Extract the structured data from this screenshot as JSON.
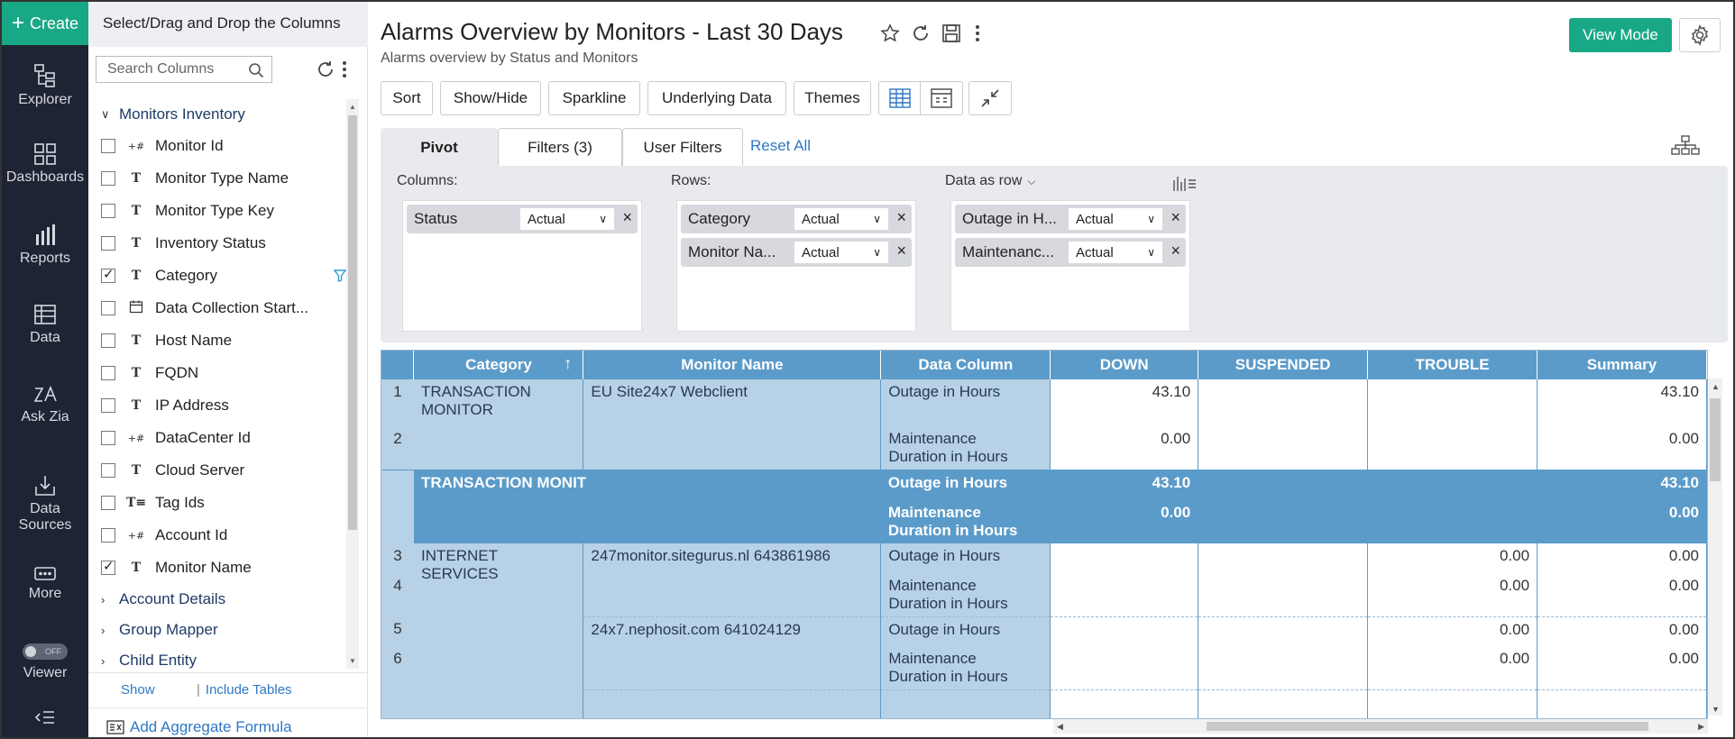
{
  "nav": {
    "create": "Create",
    "items": [
      {
        "label": "Explorer",
        "icon": "explorer-icon"
      },
      {
        "label": "Dashboards",
        "icon": "dashboards-icon"
      },
      {
        "label": "Reports",
        "icon": "reports-icon"
      },
      {
        "label": "Data",
        "icon": "data-icon"
      },
      {
        "label": "Ask Zia",
        "icon": "ask-zia-icon"
      },
      {
        "label": "Data\nSources",
        "line1": "Data",
        "line2": "Sources",
        "icon": "data-sources-icon"
      },
      {
        "label": "More",
        "icon": "more-icon"
      },
      {
        "label": "Viewer",
        "icon": "viewer-toggle"
      }
    ],
    "toggle_text": "OFF",
    "collapse_icon": "collapse-icon"
  },
  "columns_panel": {
    "header": "Select/Drag and Drop the Columns",
    "search_placeholder": "Search Columns",
    "group_open": "Monitors Inventory",
    "columns": [
      {
        "name": "Monitor Id",
        "type": "num",
        "checked": false
      },
      {
        "name": "Monitor Type Name",
        "type": "text",
        "checked": false
      },
      {
        "name": "Monitor Type Key",
        "type": "text",
        "checked": false
      },
      {
        "name": "Inventory Status",
        "type": "text",
        "checked": false
      },
      {
        "name": "Category",
        "type": "text",
        "checked": true,
        "filtered": true
      },
      {
        "name": "Data Collection Start...",
        "type": "date",
        "checked": false
      },
      {
        "name": "Host Name",
        "type": "text",
        "checked": false
      },
      {
        "name": "FQDN",
        "type": "text",
        "checked": false
      },
      {
        "name": "IP Address",
        "type": "text",
        "checked": false
      },
      {
        "name": "DataCenter Id",
        "type": "num",
        "checked": false
      },
      {
        "name": "Cloud Server",
        "type": "text",
        "checked": false
      },
      {
        "name": "Tag Ids",
        "type": "list",
        "checked": false
      },
      {
        "name": "Account Id",
        "type": "num",
        "checked": false
      },
      {
        "name": "Monitor Name",
        "type": "text",
        "checked": true
      }
    ],
    "groups_closed": [
      "Account Details",
      "Group Mapper",
      "Child Entity"
    ],
    "show_link": "Show",
    "include_tables_link": "Include Tables",
    "add_formula": "Add Aggregate Formula"
  },
  "header": {
    "title": "Alarms Overview by Monitors - Last 30 Days",
    "subtitle": "Alarms overview by Status and Monitors",
    "view_mode": "View Mode"
  },
  "toolbar": {
    "sort": "Sort",
    "show_hide": "Show/Hide",
    "sparkline": "Sparkline",
    "underlying": "Underlying Data",
    "themes": "Themes"
  },
  "tabs": {
    "pivot": "Pivot",
    "filters": "Filters  (3)",
    "user_filters": "User Filters",
    "reset_all": "Reset All"
  },
  "shelves": {
    "columns_label": "Columns:",
    "rows_label": "Rows:",
    "data_label": "Data as row",
    "columns": [
      {
        "name": "Status",
        "agg": "Actual"
      }
    ],
    "rows": [
      {
        "name": "Category",
        "agg": "Actual"
      },
      {
        "name": "Monitor Na...",
        "agg": "Actual"
      }
    ],
    "data": [
      {
        "name": "Outage in H...",
        "agg": "Actual"
      },
      {
        "name": "Maintenanc...",
        "agg": "Actual"
      }
    ]
  },
  "grid": {
    "headers": [
      "Category",
      "Monitor Name",
      "Data Column",
      "DOWN",
      "SUSPENDED",
      "TROUBLE",
      "Summary"
    ],
    "rows": [
      {
        "n": "1",
        "cat": "TRANSACTION\nMONITOR",
        "cat1": "TRANSACTION",
        "cat2": "MONITOR",
        "mon": "EU Site24x7 Webclient",
        "dc": "Outage in Hours",
        "down": "43.10",
        "susp": "",
        "trouble": "",
        "sum": "43.10"
      },
      {
        "n": "2",
        "dc1": "Maintenance",
        "dc2": "Duration in Hours",
        "down": "0.00",
        "susp": "",
        "trouble": "",
        "sum": "0.00"
      },
      {
        "sub": true,
        "cat": "TRANSACTION MONIT",
        "dc": "Outage in Hours",
        "down": "43.10",
        "sum": "43.10"
      },
      {
        "sub": true,
        "dc1": "Maintenance",
        "dc2": "Duration in Hours",
        "down": "0.00",
        "sum": "0.00"
      },
      {
        "n": "3",
        "cat": "INTERNET SERVICES",
        "mon": "247monitor.sitegurus.nl 643861986",
        "dc": "Outage in Hours",
        "down": "",
        "susp": "",
        "trouble": "0.00",
        "sum": "0.00"
      },
      {
        "n": "4",
        "dc1": "Maintenance",
        "dc2": "Duration in Hours",
        "down": "",
        "susp": "",
        "trouble": "0.00",
        "sum": "0.00"
      },
      {
        "n": "5",
        "mon": "24x7.nephosit.com 641024129",
        "dc": "Outage in Hours",
        "down": "",
        "susp": "",
        "trouble": "0.00",
        "sum": "0.00"
      },
      {
        "n": "6",
        "dc1": "Maintenance",
        "dc2": "Duration in Hours",
        "down": "",
        "susp": "",
        "trouble": "0.00",
        "sum": "0.00"
      }
    ]
  }
}
